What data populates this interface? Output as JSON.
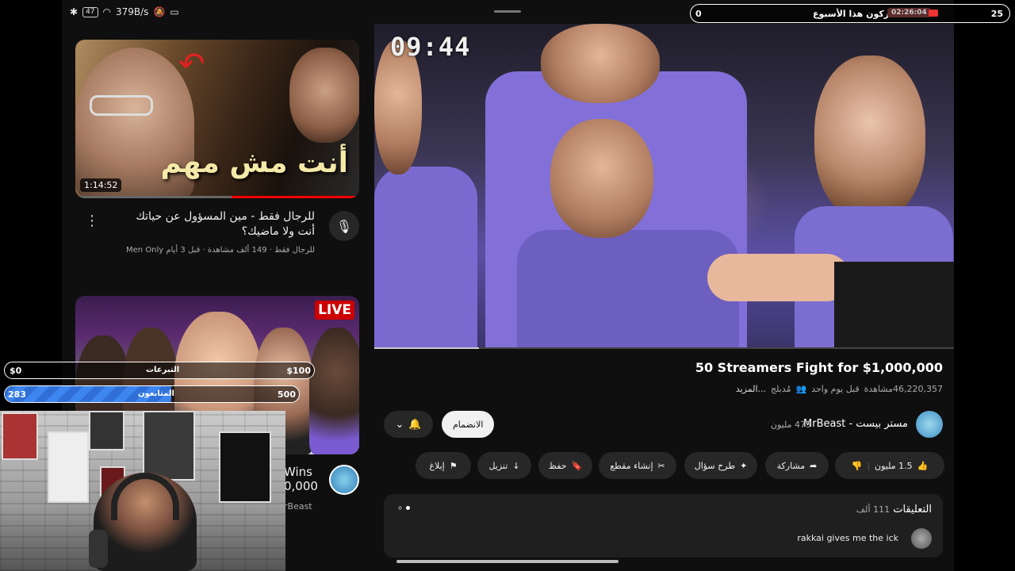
{
  "status_bar": {
    "battery": "47",
    "speed": "379B/s"
  },
  "feed": {
    "video1": {
      "thumb_text": "أنت مش مهم",
      "duration": "1:14:52",
      "title": "للرجال فقط - مين المسؤول عن حياتك أنت ولا ماضيك؟",
      "meta": "للرجال فقط · 149 ألف مشاهدة · قبل 3 أيام Men Only"
    },
    "video2": {
      "badge": "LIVE",
      "title": "Wins",
      "title_line2": "0,000",
      "channel": "rBeast"
    }
  },
  "player": {
    "timer": "09:44"
  },
  "video_info": {
    "title": "50 Streamers Fight for $1,000,000",
    "views": "46,220,357مشاهدة",
    "time": "قبل يوم واحد",
    "tag": "مُدبلج",
    "more": "...المزيد"
  },
  "channel": {
    "name": "مستر بيست - MrBeast",
    "subs": "475 مليون",
    "join": "الانضمام"
  },
  "actions": {
    "likes": "1.5 مليون",
    "share": "مشاركة",
    "ask": "طرح سؤال",
    "clip": "إنشاء مقطع",
    "save": "حفظ",
    "download": "تنزيل",
    "report": "إبلاغ"
  },
  "comments": {
    "label": "التعليقات",
    "count": "111 ألف",
    "first_comment": "rakkai gives me the ick"
  },
  "overlay": {
    "top_left": "0",
    "top_right": "25",
    "top_text": "المشتركون هذا الأسبوع",
    "clock": "02:26:04",
    "donations_label": "التبرعات",
    "donations_value": "$0",
    "donations_goal": "$100",
    "followers_label": "المتابعون",
    "followers_value": "283",
    "followers_goal": "500",
    "followers_progress": 0.566
  },
  "colors": {
    "accent_red": "#ff0000",
    "follower_bar": "#2f6fd6",
    "background": "#0f0f0f"
  }
}
